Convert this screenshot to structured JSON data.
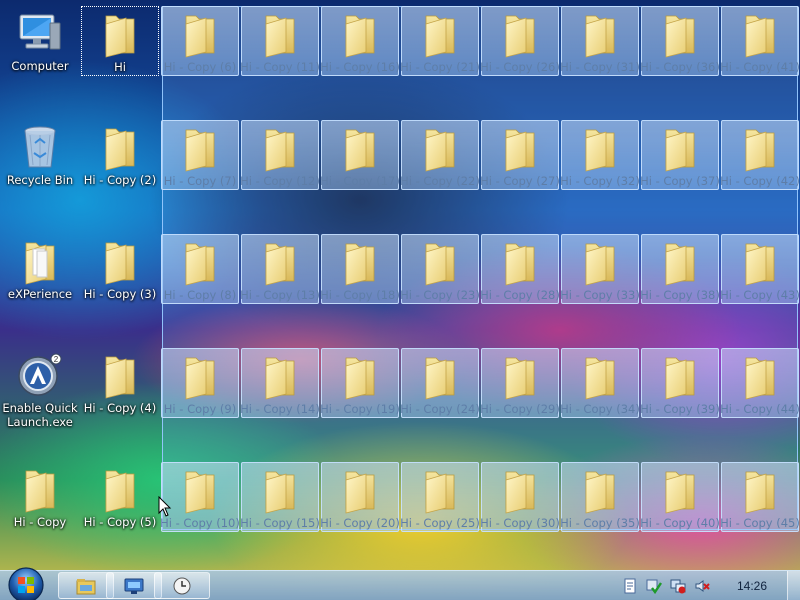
{
  "desktop": {
    "left_column": [
      {
        "label": "Computer",
        "icon": "computer-icon"
      },
      {
        "label": "Recycle Bin",
        "icon": "recycle-bin-icon"
      },
      {
        "label": "eXPerience",
        "icon": "folder-documents-icon"
      },
      {
        "label": "Enable Quick Launch.exe",
        "icon": "quick-launch-app-icon"
      },
      {
        "label": "Hi - Copy",
        "icon": "folder-icon"
      }
    ],
    "second_column": [
      {
        "label": "Hi",
        "icon": "folder-icon"
      },
      {
        "label": "Hi - Copy (2)",
        "icon": "folder-icon"
      },
      {
        "label": "Hi - Copy (3)",
        "icon": "folder-icon"
      },
      {
        "label": "Hi - Copy (4)",
        "icon": "folder-icon"
      },
      {
        "label": "Hi - Copy (5)",
        "icon": "folder-icon"
      }
    ],
    "selected_folders": [
      "Hi - Copy (6)",
      "Hi - Copy (7)",
      "Hi - Copy (8)",
      "Hi - Copy (9)",
      "Hi - Copy (10)",
      "Hi - Copy (11)",
      "Hi - Copy (12)",
      "Hi - Copy (13)",
      "Hi - Copy (14)",
      "Hi - Copy (15)",
      "Hi - Copy (16)",
      "Hi - Copy (17)",
      "Hi - Copy (18)",
      "Hi - Copy (19)",
      "Hi - Copy (20)",
      "Hi - Copy (21)",
      "Hi - Copy (22)",
      "Hi - Copy (23)",
      "Hi - Copy (24)",
      "Hi - Copy (25)",
      "Hi - Copy (26)",
      "Hi - Copy (27)",
      "Hi - Copy (28)",
      "Hi - Copy (29)",
      "Hi - Copy (30)",
      "Hi - Copy (31)",
      "Hi - Copy (32)",
      "Hi - Copy (33)",
      "Hi - Copy (34)",
      "Hi - Copy (35)",
      "Hi - Copy (36)",
      "Hi - Copy (37)",
      "Hi - Copy (38)",
      "Hi - Copy (39)",
      "Hi - Copy (40)",
      "Hi - Copy (41)",
      "Hi - Copy (42)",
      "Hi - Copy (43)",
      "Hi - Copy (44)",
      "Hi - Copy (45)"
    ],
    "selection_color": "#64a0e6",
    "folder_color": "#f3e08a"
  },
  "taskbar": {
    "clock": "14:26",
    "pinned": [
      "explorer-icon",
      "media-center-icon",
      "clock-app-icon"
    ],
    "tray": [
      "document-icon",
      "security-check-icon",
      "network-error-icon",
      "volume-muted-icon"
    ],
    "colors": {
      "bar": "#8fb3d9",
      "text": "#10233e"
    }
  }
}
